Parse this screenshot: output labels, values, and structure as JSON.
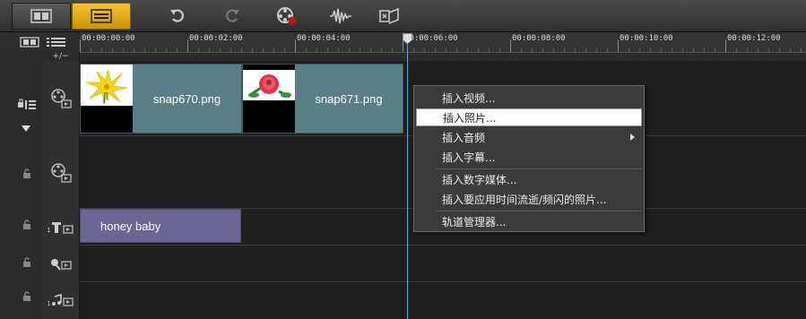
{
  "toolbar": {
    "buttons": [
      {
        "name": "storyboard-view-button",
        "icon": "film-strip-icon",
        "active": false
      },
      {
        "name": "timeline-view-button",
        "icon": "timeline-icon",
        "active": true
      }
    ],
    "tools": [
      "undo-icon",
      "redo-icon",
      "record-capture-icon",
      "audio-waveform-icon",
      "auto-music-icon"
    ]
  },
  "ruler": {
    "ticks": [
      "00:00:00:00",
      "00:00:02:00",
      "00:00:04:00",
      "00:00:06:00",
      "00:00:08:00",
      "00:00:10:00",
      "00:00:12:00"
    ]
  },
  "zoom_control_label": "+/−",
  "tracks": {
    "video": {
      "clips": [
        {
          "name": "snap670.png",
          "thumb": "yellow-flower"
        },
        {
          "name": "snap671.png",
          "thumb": "red-rose"
        }
      ]
    },
    "overlay": {},
    "title": {
      "track_number": "1",
      "clip": "honey baby"
    },
    "voice": {},
    "music": {
      "track_number": "1"
    }
  },
  "context_menu": {
    "items": [
      {
        "label": "插入视频..."
      },
      {
        "label": "插入照片...",
        "hover": true
      },
      {
        "label": "插入音频",
        "submenu": true
      },
      {
        "label": "插入字幕..."
      },
      {
        "label": "插入数字媒体..."
      },
      {
        "label": "插入要应用时间流逝/频闪的照片..."
      },
      {
        "label": "轨道管理器..."
      }
    ]
  },
  "colors": {
    "accent": "#e8b51e",
    "video_clip": "#5a7e86",
    "title_clip": "#6b6694",
    "playhead": "#4aa0e0"
  }
}
